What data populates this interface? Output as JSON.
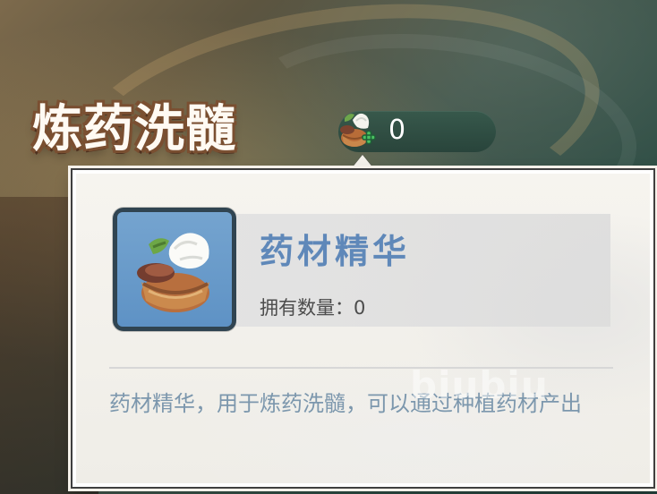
{
  "page": {
    "title": "炼药洗髓"
  },
  "resource": {
    "value": "0",
    "icon": "herb-essence-icon"
  },
  "item": {
    "name": "药材精华",
    "owned_label": "拥有数量：",
    "owned_value": "0",
    "description": "药材精华，用于炼药洗髓，可以通过种植药材产出"
  },
  "watermark": {
    "text": "biubiu"
  },
  "colors": {
    "title_fill": "#fffaf3",
    "title_stroke": "#7a4f31",
    "name": "#5f88b9",
    "description": "#7c97ad",
    "panel": "#f0eee8",
    "icon_frame": "#304451",
    "icon_bg": "#6797c7"
  }
}
